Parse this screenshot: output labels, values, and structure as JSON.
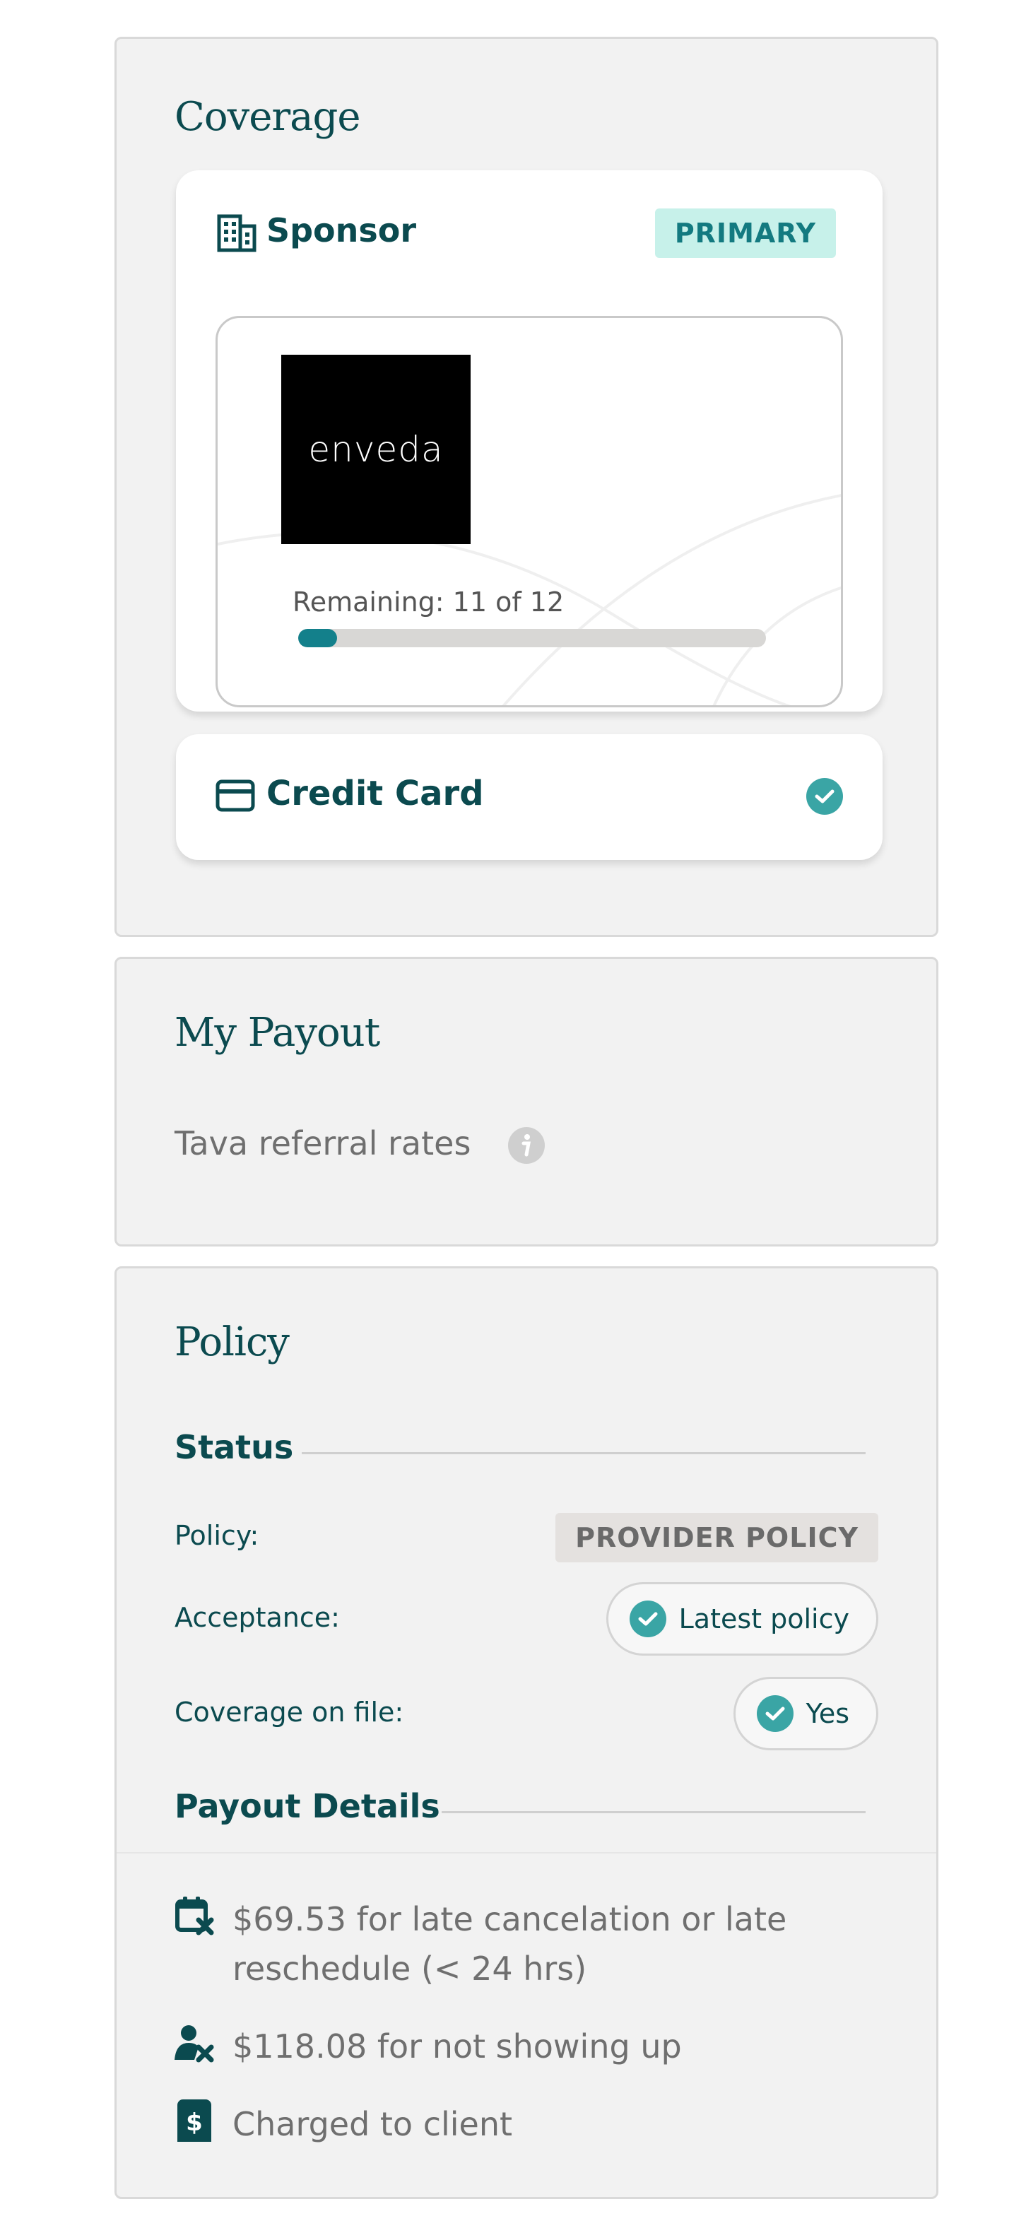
{
  "coverage": {
    "title": "Coverage",
    "sponsor": {
      "label": "Sponsor",
      "badge": "PRIMARY",
      "logo_text": "enveda",
      "remaining_text": "Remaining: 11 of 12",
      "remaining_fraction": 0.0833
    },
    "credit_card": {
      "label": "Credit Card"
    }
  },
  "payout": {
    "title": "My Payout",
    "referral_label": "Tava referral rates"
  },
  "policy": {
    "title": "Policy",
    "status_heading": "Status",
    "rows": [
      {
        "label": "Policy:",
        "value": "PROVIDER POLICY"
      },
      {
        "label": "Acceptance:",
        "value": "Latest policy"
      },
      {
        "label": "Coverage on file:",
        "value": "Yes"
      }
    ],
    "payout_details_heading": "Payout Details",
    "details": [
      {
        "icon": "calendar-x-icon",
        "text": "$69.53 for late cancelation or late reschedule (< 24 hrs)"
      },
      {
        "icon": "user-x-icon",
        "text": "$118.08 for not showing up"
      },
      {
        "icon": "dollar-card-icon",
        "text": "Charged to client"
      }
    ]
  },
  "colors": {
    "primary_text": "#0b4a4f",
    "accent_teal": "#3aa5a5",
    "progress_fill": "#13808b",
    "badge_bg": "#c7f1ea",
    "panel_bg": "#f2f2f2"
  }
}
